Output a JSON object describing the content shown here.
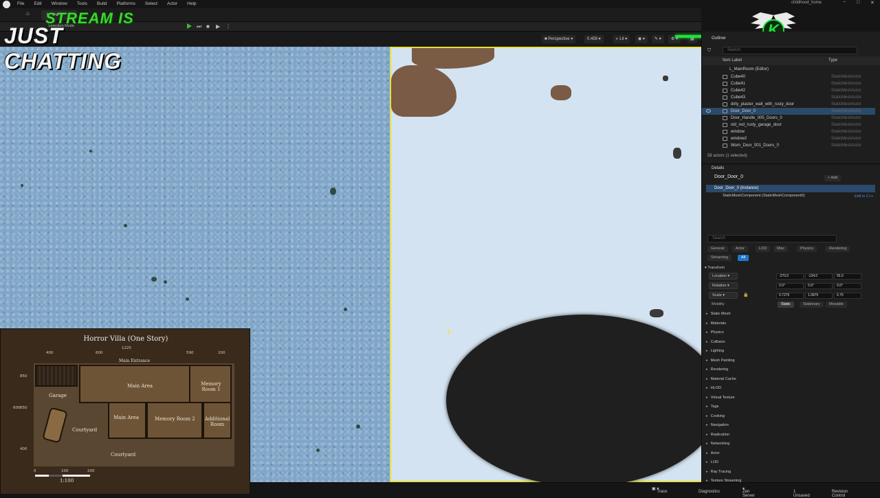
{
  "menubar": {
    "items": [
      "File",
      "Edit",
      "Window",
      "Tools",
      "Build",
      "Platforms",
      "Select",
      "Actor",
      "Help"
    ],
    "project_name": "childhood_home",
    "window_controls": [
      "−",
      "□",
      "✕"
    ]
  },
  "editor_tab": {
    "label": "L_MainRoom"
  },
  "toolbar": {
    "mode_label": "Selection Mode"
  },
  "viewport_bar": {
    "perspective": "Perspective",
    "fov": "0.459",
    "lit": "Lit"
  },
  "overlay": {
    "line1": "STREAM IS",
    "line2": "JUST CHATTING",
    "logo_letter": "K",
    "accent_color": "#20e03a"
  },
  "outliner": {
    "tab_label": "Outliner",
    "search_placeholder": "Search",
    "col_label": "Item Label",
    "col_type": "Type",
    "root": "L_MainRoom (Editor)",
    "rows": [
      {
        "name": "Cube40",
        "type": "StaticMeshActor",
        "selected": false
      },
      {
        "name": "Cube41",
        "type": "StaticMeshActor",
        "selected": false
      },
      {
        "name": "Cube42",
        "type": "StaticMeshActor",
        "selected": false
      },
      {
        "name": "Cube43",
        "type": "StaticMeshActor",
        "selected": false
      },
      {
        "name": "dirty_plaster_wall_with_rusty_door",
        "type": "StaticMeshActor",
        "selected": false
      },
      {
        "name": "Door_Door_0",
        "type": "StaticMeshActor",
        "selected": true
      },
      {
        "name": "Door_Handle_005_Doors_0",
        "type": "StaticMeshActor",
        "selected": false
      },
      {
        "name": "old_red_rusty_garage_door",
        "type": "StaticMeshActor",
        "selected": false
      },
      {
        "name": "window",
        "type": "StaticMeshActor",
        "selected": false
      },
      {
        "name": "window2",
        "type": "StaticMeshActor",
        "selected": false
      },
      {
        "name": "Worn_Door_001_Doors_0",
        "type": "StaticMeshActor",
        "selected": false
      }
    ],
    "count": "58 actors (1 selected)"
  },
  "details": {
    "tab_label": "Details",
    "actor_name": "Door_Door_0",
    "add_label": "Add",
    "instance_label": "Door_Door_0 (Instance)",
    "component_label": "StaticMeshComponent (StaticMeshComponent0)",
    "edit_cpp": "Edit in C++",
    "search_placeholder": "Search",
    "filters": [
      "General",
      "Actor",
      "LOD",
      "Misc",
      "Physics",
      "Rendering",
      "Streaming",
      "All"
    ],
    "transform_label": "Transform",
    "location": {
      "label": "Location",
      "x": "-270.0",
      "y": "-134.0",
      "z": "55.0"
    },
    "rotation": {
      "label": "Rotation",
      "x": "0.0°",
      "y": "0.0°",
      "z": "0.0°"
    },
    "scale": {
      "label": "Scale",
      "x": "0.7275",
      "y": "1.0875",
      "z": "0.75"
    },
    "mobility": {
      "label": "Mobility",
      "options": [
        "Static",
        "Stationary",
        "Movable"
      ]
    },
    "categories": [
      "Static Mesh",
      "Materials",
      "Physics",
      "Collision",
      "Lighting",
      "Mesh Painting",
      "Rendering",
      "Material Cache",
      "HLOD",
      "Virtual Texture",
      "Tags",
      "Cooking",
      "Navigation",
      "Replication",
      "Networking",
      "Actor",
      "LOD",
      "Ray Tracing",
      "Texture Streaming"
    ]
  },
  "statusbar": {
    "trace": "Trace",
    "diagnostics": "Diagnostics",
    "zen": "Zen Server",
    "unsaved": "1 Unsaved",
    "revision": "Revision Control"
  },
  "floorplan": {
    "title": "Horror Villa (One Story)",
    "total_width": "1225",
    "top_dims": [
      "400",
      "600",
      "590",
      "200"
    ],
    "side_dims": [
      "850",
      "600",
      "650",
      "400"
    ],
    "rooms": [
      "Main Entrance",
      "Garage",
      "Main Area",
      "Memory Room 1",
      "Courtyard",
      "Main Area",
      "Memory Room 2",
      "Additional Room",
      "Courtyard"
    ],
    "scale_ticks": [
      "0",
      "100",
      "200"
    ],
    "scale_label": "1:100"
  }
}
